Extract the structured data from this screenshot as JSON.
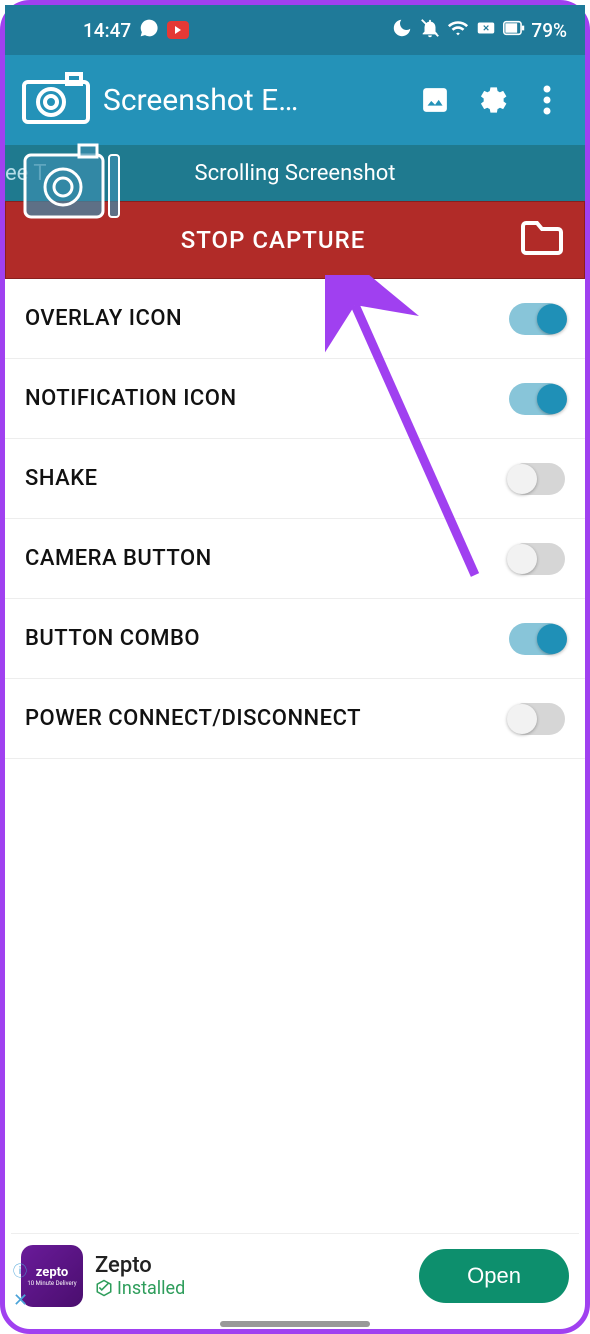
{
  "status": {
    "time": "14:47",
    "battery": "79%"
  },
  "appbar": {
    "title": "Screenshot E…"
  },
  "subbar": {
    "partial": "ee T",
    "title": "Scrolling Screenshot"
  },
  "capture": {
    "label": "STOP CAPTURE"
  },
  "settings": [
    {
      "label": "OVERLAY ICON",
      "on": true
    },
    {
      "label": "NOTIFICATION ICON",
      "on": true
    },
    {
      "label": "SHAKE",
      "on": false
    },
    {
      "label": "CAMERA BUTTON",
      "on": false
    },
    {
      "label": "BUTTON COMBO",
      "on": true
    },
    {
      "label": "POWER CONNECT/DISCONNECT",
      "on": false
    }
  ],
  "ad": {
    "brand": "zepto",
    "subtitle": "10 Minute Delivery",
    "title": "Zepto",
    "status": "Installed",
    "cta": "Open"
  }
}
